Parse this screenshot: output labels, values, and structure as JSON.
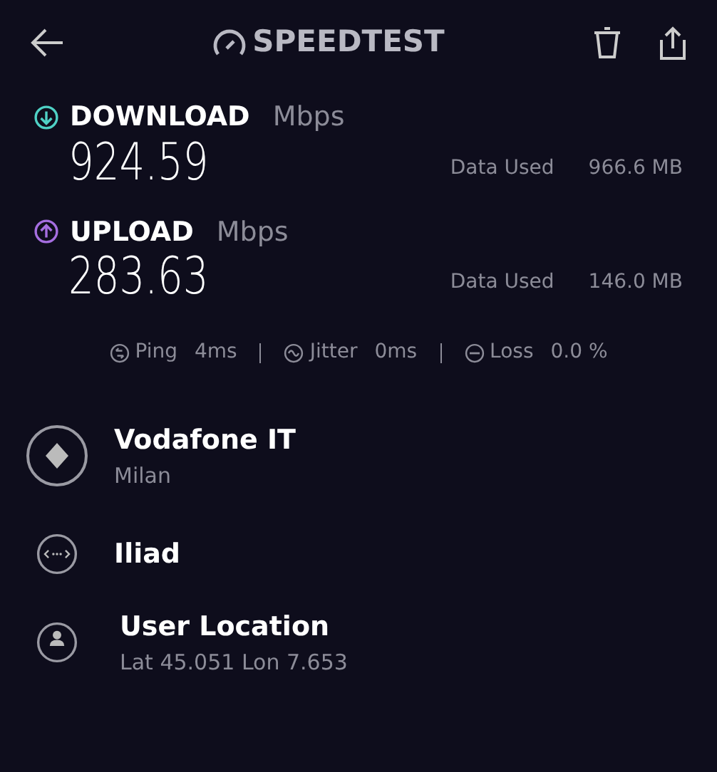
{
  "header": {
    "logo": "SPEEDTEST"
  },
  "metrics": [
    {
      "kind": "download",
      "label": "DOWNLOAD",
      "unit": "Mbps",
      "value": "924.59",
      "data_label": "Data Used",
      "data_value": "966.6 MB",
      "color": "#4fd1c5"
    },
    {
      "kind": "upload",
      "label": "UPLOAD",
      "unit": "Mbps",
      "value": "283.63",
      "data_label": "Data Used",
      "data_value": "146.0 MB",
      "color": "#a56ee0"
    }
  ],
  "stats": [
    {
      "kind": "ping",
      "label": "Ping",
      "value": "4ms"
    },
    {
      "kind": "jitter",
      "label": "Jitter",
      "value": "0ms"
    },
    {
      "kind": "loss",
      "label": "Loss",
      "value": "0.0 %"
    }
  ],
  "servers": [
    {
      "kind": "server",
      "name": "Vodafone IT",
      "detail": "Milan"
    },
    {
      "kind": "isp",
      "name": "Iliad"
    },
    {
      "kind": "user",
      "name": "User Location",
      "detail": "Lat 45.051 Lon 7.653"
    }
  ]
}
